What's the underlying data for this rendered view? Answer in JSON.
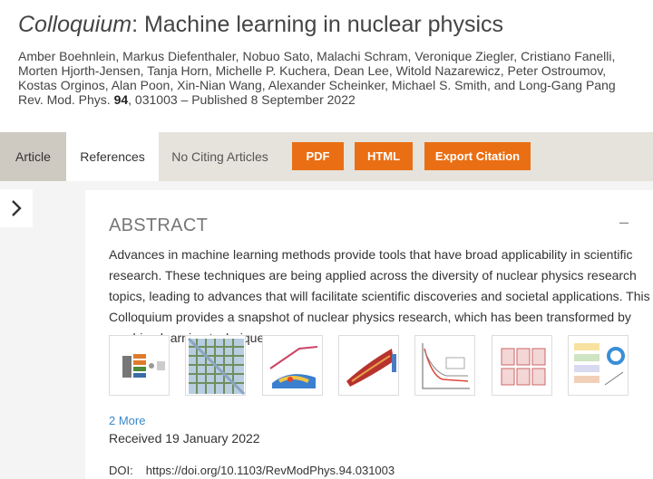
{
  "title": {
    "italic": "Colloquium",
    "rest": ": Machine learning in nuclear physics"
  },
  "authors": "Amber Boehnlein, Markus Diefenthaler, Nobuo Sato, Malachi Schram, Veronique Ziegler, Cristiano Fanelli, Morten Hjorth-Jensen, Tanja Horn, Michelle P. Kuchera, Dean Lee, Witold Nazarewicz, Peter Ostroumov, Kostas Orginos, Alan Poon, Xin-Nian Wang, Alexander Scheinker, Michael S. Smith, and Long-Gang Pang",
  "citation": {
    "journal": "Rev. Mod. Phys.",
    "volume": "94",
    "article": ", 031003 – Published 8 September 2022"
  },
  "tabs": {
    "article": "Article",
    "references": "References",
    "citing": "No Citing Articles"
  },
  "buttons": {
    "pdf": "PDF",
    "html": "HTML",
    "export": "Export Citation"
  },
  "abstract": {
    "heading": "ABSTRACT",
    "collapse": "–",
    "text": "Advances in machine learning methods provide tools that have broad applicability in scientific research. These techniques are being applied across the diversity of nuclear physics research topics, leading to advances that will facilitate scientific discoveries and societal applications. This Colloquium provides a snapshot of nuclear physics research, which has been transformed by machine learning techniques."
  },
  "figures": {
    "more": "2 More"
  },
  "received": "Received 19 January 2022",
  "doi": {
    "label": "DOI:",
    "value": "https://doi.org/10.1103/RevModPhys.94.031003"
  },
  "colors": {
    "accent": "#ea6f14",
    "link": "#3b88c8",
    "tabbar": "#e6e2dc"
  },
  "icons": {
    "side_toggle": "chevron-right-icon"
  }
}
